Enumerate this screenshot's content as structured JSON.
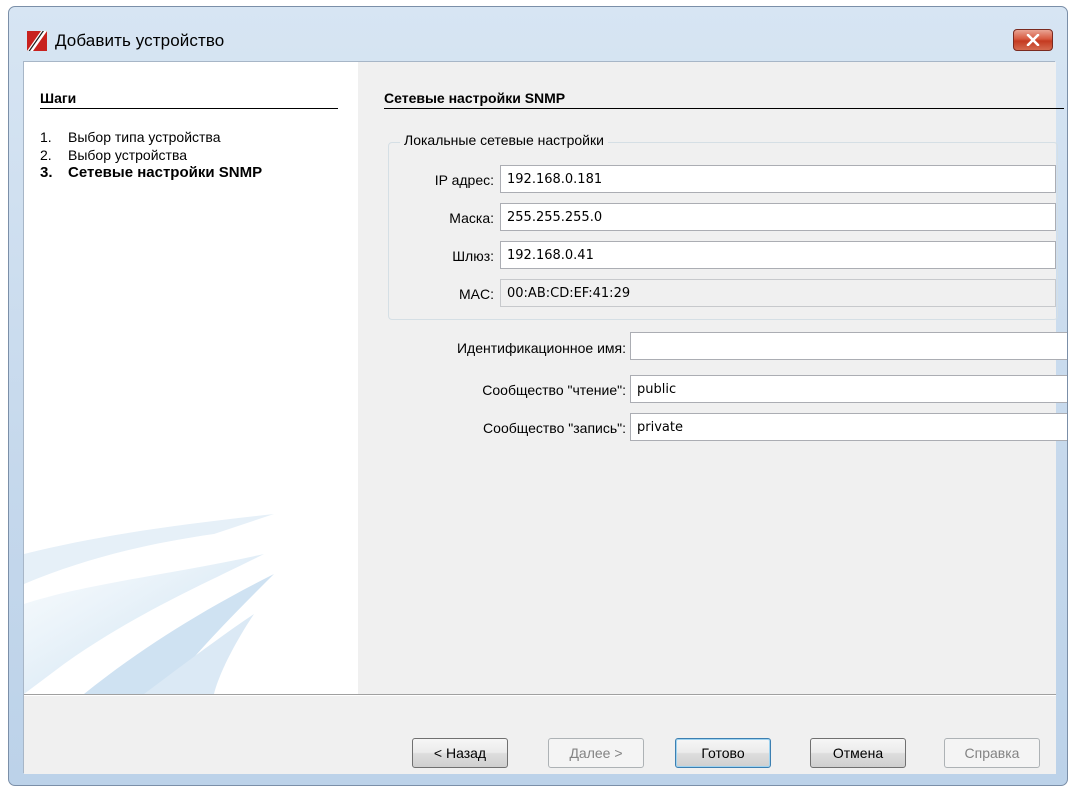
{
  "window": {
    "title": "Добавить устройство"
  },
  "steps": {
    "heading": "Шаги",
    "items": [
      {
        "num": "1.",
        "label": "Выбор типа устройства"
      },
      {
        "num": "2.",
        "label": "Выбор устройства"
      },
      {
        "num": "3.",
        "label": "Сетевые настройки SNMP"
      }
    ]
  },
  "main": {
    "title": "Сетевые настройки SNMP",
    "group": {
      "legend": "Локальные сетевые настройки",
      "ip_label": "IP адрес:",
      "ip_value": "192.168.0.181",
      "mask_label": "Маска:",
      "mask_value": "255.255.255.0",
      "gateway_label": "Шлюз:",
      "gateway_value": "192.168.0.41",
      "mac_label": "MAC:",
      "mac_value": "00:AB:CD:EF:41:29"
    },
    "ident_label": "Идентификационное имя:",
    "ident_value": "",
    "read_label": "Сообщество \"чтение\":",
    "read_value": "public",
    "write_label": "Сообщество \"запись\":",
    "write_value": "private"
  },
  "buttons": {
    "back": "< Назад",
    "next": "Далее >",
    "finish": "Готово",
    "cancel": "Отмена",
    "help": "Справка"
  },
  "colors": {
    "title_bar": "#c5d8ec",
    "close_button": "#c43a20",
    "accent_red": "#c8211e"
  },
  "icons": {
    "app": "app-logo-icon",
    "close": "close-icon"
  }
}
